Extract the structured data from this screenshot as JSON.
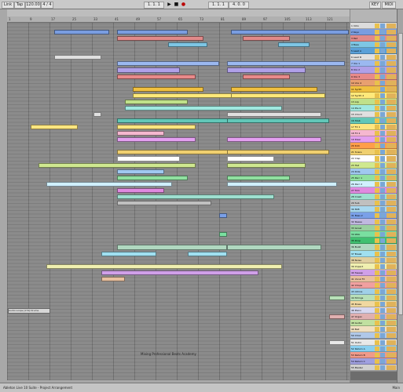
{
  "transport": {
    "left_tabs": [
      "Link",
      "Tap",
      "120.00",
      "4 / 4"
    ],
    "position": "1. 1. 1",
    "right_fields": [
      "1. 1. 1",
      "4. 0. 0"
    ],
    "key_label": "KEY",
    "midi_label": "MIDI"
  },
  "ruler_ticks": [
    "1",
    "9",
    "17",
    "25",
    "33",
    "41",
    "49",
    "57",
    "65",
    "73",
    "81",
    "89",
    "97",
    "105",
    "113",
    "121"
  ],
  "arrangement": {
    "loop_label": "Audio Loops [174] Drums",
    "center_hint": "Mixing Professional Beats Academy"
  },
  "tracks": [
    {
      "name": "1 Intro",
      "color": "#dcdcdc"
    },
    {
      "name": "2 Keys",
      "color": "#7a9de0"
    },
    {
      "name": "3 Pad",
      "color": "#e08a8a"
    },
    {
      "name": "4 Bass",
      "color": "#7ec6e4"
    },
    {
      "name": "5 Lead A",
      "color": "#5aa0d8"
    },
    {
      "name": "6 Lead B",
      "color": "#e0e0e0"
    },
    {
      "name": "7 Vox 1",
      "color": "#9bb8f0"
    },
    {
      "name": "8 Vox 2",
      "color": "#b0a0e8"
    },
    {
      "name": "9 Vox 3",
      "color": "#e88a8a"
    },
    {
      "name": "10 Vox 4",
      "color": "#e8a070"
    },
    {
      "name": "11 Synth",
      "color": "#f0c040"
    },
    {
      "name": "12 Synth 2",
      "color": "#ffe97a"
    },
    {
      "name": "13 Arp",
      "color": "#c0e08a"
    },
    {
      "name": "14 Pluck",
      "color": "#a0e8e0"
    },
    {
      "name": "15 Chord",
      "color": "#e0e0e0"
    },
    {
      "name": "16 Stab",
      "color": "#62c7b8"
    },
    {
      "name": "17 FX 1",
      "color": "#ffe680"
    },
    {
      "name": "18 FX 2",
      "color": "#f5b7d0"
    },
    {
      "name": "19 Riser",
      "color": "#e3a0f0"
    },
    {
      "name": "20 Kick",
      "color": "#ff9e4a"
    },
    {
      "name": "21 Snare",
      "color": "#f0d070"
    },
    {
      "name": "22 Clap",
      "color": "#ffffff"
    },
    {
      "name": "23 Hat",
      "color": "#cfe890"
    },
    {
      "name": "24 Ride",
      "color": "#a0c8f0"
    },
    {
      "name": "25 Perc 1",
      "color": "#90e0a0"
    },
    {
      "name": "26 Perc 2",
      "color": "#d0f0ff"
    },
    {
      "name": "27 Tom",
      "color": "#e08ae0"
    },
    {
      "name": "28 Crash",
      "color": "#9ee0d0"
    },
    {
      "name": "29 Sub",
      "color": "#c0c0c0"
    },
    {
      "name": "30 808",
      "color": "#a8d8f0"
    },
    {
      "name": "31 Bass 2",
      "color": "#7aa0e8"
    },
    {
      "name": "32 Reese",
      "color": "#c0b8e0"
    },
    {
      "name": "33 Growl",
      "color": "#9ad0a0"
    },
    {
      "name": "34 Wob",
      "color": "#7adfa0"
    },
    {
      "name": "35 Drop",
      "color": "#40c070"
    },
    {
      "name": "36 Build",
      "color": "#b0d8c0"
    },
    {
      "name": "37 Break",
      "color": "#a0e0f0"
    },
    {
      "name": "38 Noise",
      "color": "#e0d0a0"
    },
    {
      "name": "39 Impact",
      "color": "#f0f0b0"
    },
    {
      "name": "40 Sweep",
      "color": "#d0a0e8"
    },
    {
      "name": "41 Vocal FX",
      "color": "#e8c0a0"
    },
    {
      "name": "42 Chops",
      "color": "#f0a0a0"
    },
    {
      "name": "43 Atmos",
      "color": "#a0d0e8"
    },
    {
      "name": "44 Strings",
      "color": "#b8e0b8"
    },
    {
      "name": "45 Brass",
      "color": "#f0d8a0"
    },
    {
      "name": "46 Piano",
      "color": "#d8d8f0"
    },
    {
      "name": "47 Organ",
      "color": "#e0b0b0"
    },
    {
      "name": "48 Guitar",
      "color": "#c0e0a0"
    },
    {
      "name": "49 Bell",
      "color": "#f0e0c0"
    },
    {
      "name": "50 Choir",
      "color": "#b0c8e8"
    },
    {
      "name": "51 Outro",
      "color": "#e8e8e8"
    },
    {
      "name": "52 Return A",
      "color": "#8ad0f0"
    },
    {
      "name": "53 Return B",
      "color": "#f09a8a"
    },
    {
      "name": "54 Return C",
      "color": "#a0a0e0"
    },
    {
      "name": "55 Master",
      "color": "#d0d0d0"
    }
  ],
  "status": {
    "left": "Ableton Live 10 Suite - Project Arrangement",
    "right": "Main"
  }
}
